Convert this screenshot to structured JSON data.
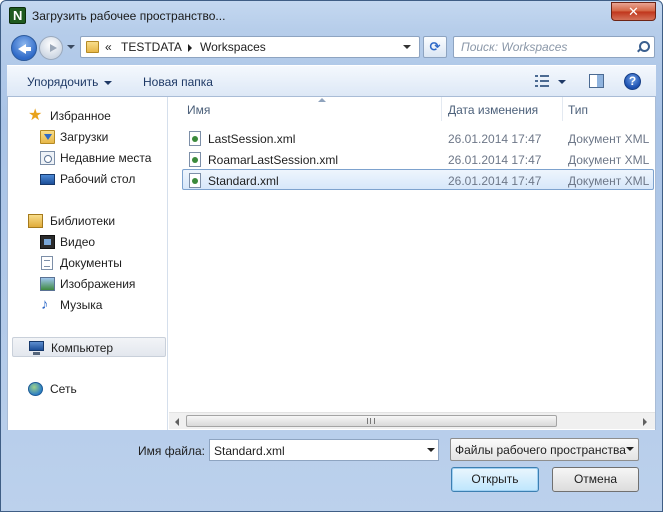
{
  "window": {
    "title": "Загрузить рабочее пространство...",
    "close_label": "✕"
  },
  "address": {
    "overflow": "«",
    "crumbs": [
      "TESTDATA",
      "Workspaces"
    ]
  },
  "search": {
    "placeholder": "Поиск: Workspaces"
  },
  "toolbar": {
    "organize_label": "Упорядочить",
    "new_folder_label": "Новая папка",
    "help_label": "?"
  },
  "nav": {
    "favorites": {
      "label": "Избранное",
      "items": [
        {
          "label": "Загрузки",
          "icon": "downloads-icon"
        },
        {
          "label": "Недавние места",
          "icon": "recent-places-icon"
        },
        {
          "label": "Рабочий стол",
          "icon": "desktop-icon"
        }
      ]
    },
    "libraries": {
      "label": "Библиотеки",
      "items": [
        {
          "label": "Видео",
          "icon": "video-icon"
        },
        {
          "label": "Документы",
          "icon": "documents-icon"
        },
        {
          "label": "Изображения",
          "icon": "pictures-icon"
        },
        {
          "label": "Музыка",
          "icon": "music-icon"
        }
      ]
    },
    "computer": {
      "label": "Компьютер"
    },
    "network": {
      "label": "Сеть"
    }
  },
  "filelist": {
    "columns": {
      "name": "Имя",
      "date": "Дата изменения",
      "type": "Тип"
    },
    "files": [
      {
        "name": "LastSession.xml",
        "date": "26.01.2014 17:47",
        "type": "Документ XML"
      },
      {
        "name": "RoamarLastSession.xml",
        "date": "26.01.2014 17:47",
        "type": "Документ XML"
      },
      {
        "name": "Standard.xml",
        "date": "26.01.2014 17:47",
        "type": "Документ XML"
      }
    ]
  },
  "bottom": {
    "filename_label": "Имя файла:",
    "filename_value": "Standard.xml",
    "filetype_value": "Файлы рабочего пространства",
    "open_label": "Открыть",
    "cancel_label": "Отмена"
  }
}
